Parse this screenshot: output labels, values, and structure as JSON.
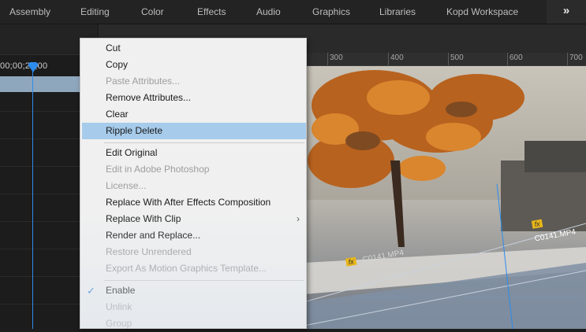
{
  "workspace_tabs": [
    "Assembly",
    "Editing",
    "Color",
    "Effects",
    "Audio",
    "Graphics",
    "Libraries",
    "Kopd Workspace"
  ],
  "more_glyph": "»",
  "timeline": {
    "timecode": "00;00;24;00"
  },
  "ruler": {
    "labels": [
      "300",
      "400",
      "500",
      "600",
      "700"
    ]
  },
  "preview": {
    "clip_label_1": "C0141.MP4",
    "clip_label_2": "C0141.MP4",
    "fx_badge": "fx"
  },
  "context_menu": {
    "items": [
      {
        "label": "Cut",
        "state": "enabled"
      },
      {
        "label": "Copy",
        "state": "enabled"
      },
      {
        "label": "Paste Attributes...",
        "state": "disabled"
      },
      {
        "label": "Remove Attributes...",
        "state": "enabled"
      },
      {
        "label": "Clear",
        "state": "enabled"
      },
      {
        "label": "Ripple Delete",
        "state": "highlighted"
      },
      {
        "label": "Edit Original",
        "state": "enabled"
      },
      {
        "label": "Edit in Adobe Photoshop",
        "state": "disabled"
      },
      {
        "label": "License...",
        "state": "disabled"
      },
      {
        "label": "Replace With After Effects Composition",
        "state": "enabled"
      },
      {
        "label": "Replace With Clip",
        "state": "enabled",
        "submenu": true
      },
      {
        "label": "Render and Replace...",
        "state": "enabled"
      },
      {
        "label": "Restore Unrendered",
        "state": "disabled"
      },
      {
        "label": "Export As Motion Graphics Template...",
        "state": "disabled"
      },
      {
        "label": "Enable",
        "state": "enabled",
        "checked": true
      },
      {
        "label": "Unlink",
        "state": "disabled"
      },
      {
        "label": "Group",
        "state": "disabled"
      }
    ],
    "check_glyph": "✓",
    "submenu_glyph": "›"
  },
  "colors": {
    "accent": "#2d8ceb",
    "menu_bg": "#f0f0f0",
    "menu_highlight": "#a6cbeb",
    "menu_disabled": "#9d9d9d",
    "clip_blue": "#8fa7bd",
    "fx_badge": "#e8b71a"
  }
}
